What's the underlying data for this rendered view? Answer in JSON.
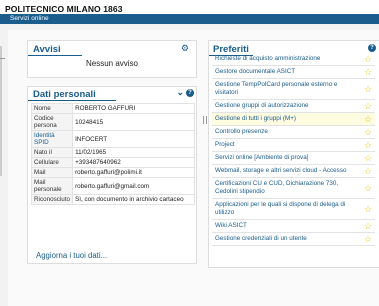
{
  "header": {
    "brand": "POLITECNICO MILANO 1863",
    "subnav_label": "Servizi online"
  },
  "avvisi": {
    "title": "Avvisi",
    "message": "Nessun avviso",
    "settings_icon": "gear-icon"
  },
  "dati": {
    "title": "Dati personali",
    "collapse_icon": "chevron-down-icon",
    "help_icon": "question-icon",
    "rows": [
      {
        "label": "Nome",
        "value": "ROBERTO GAFFURI"
      },
      {
        "label": "Codice persona",
        "value": "10248415"
      },
      {
        "label": "Identità SPID",
        "value": "INFOCERT"
      },
      {
        "label": "Nato il",
        "value": "11/02/1965"
      },
      {
        "label": "Cellulare",
        "value": "+393487640962"
      },
      {
        "label": "Mail",
        "value": "roberto.gaffuri@polimi.it"
      },
      {
        "label": "Mail personale",
        "value": "roberto.gaffuri@gmail.com"
      },
      {
        "label": "Riconosciuto",
        "value": "Sì, con documento in archivio cartaceo"
      }
    ],
    "update_link": "Aggiorna i tuoi dati..."
  },
  "preferiti": {
    "title": "Preferiti",
    "help_icon": "question-icon",
    "items": [
      {
        "label": "Richieste di acquisto amministrazione"
      },
      {
        "label": "Gestore documentale ASICT"
      },
      {
        "label": "Gestione TempPolCard personale esterno e visitatori"
      },
      {
        "label": "Gestione gruppi di autorizzazione"
      },
      {
        "label": "Gestione di tutti i gruppi (M+)"
      },
      {
        "label": "Controllo presenze"
      },
      {
        "label": "Project"
      },
      {
        "label": "Servizi online [Ambiente di prova]"
      },
      {
        "label": "Webmail, storage e altri servizi cloud - Accesso"
      },
      {
        "label": "Certificazioni CU e CUD, Dichiarazione 730, Cedolini stipendio"
      },
      {
        "label": "Applicazioni per le quali si dispone di delega di utilizzo"
      },
      {
        "label": "Wiki ASICT"
      },
      {
        "label": "Gestione credenziali di un utente"
      }
    ],
    "highlighted_index": 4,
    "star_color": "#f0c419"
  },
  "colors": {
    "accent": "#1a5d8c"
  }
}
